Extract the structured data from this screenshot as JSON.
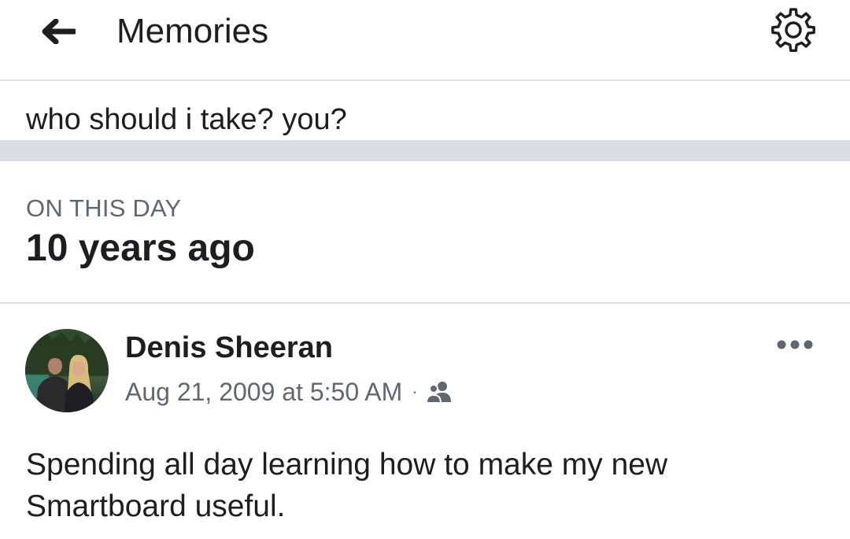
{
  "header": {
    "title": "Memories",
    "back_icon": "back-arrow-icon",
    "settings_icon": "gear-icon"
  },
  "previous_post": {
    "text": "who should i take? you?"
  },
  "memory_section": {
    "label": "ON THIS DAY",
    "heading": "10 years ago"
  },
  "post": {
    "author": "Denis Sheeran",
    "timestamp": "Aug 21, 2009 at 5:50 AM",
    "separator": "·",
    "audience_icon": "friends-icon",
    "more_icon": "more-options-icon",
    "body": "Spending all day learning how to make my new Smartboard useful."
  },
  "colors": {
    "text_primary": "#1c1e21",
    "text_secondary": "#606770",
    "divider": "#dadde1"
  }
}
